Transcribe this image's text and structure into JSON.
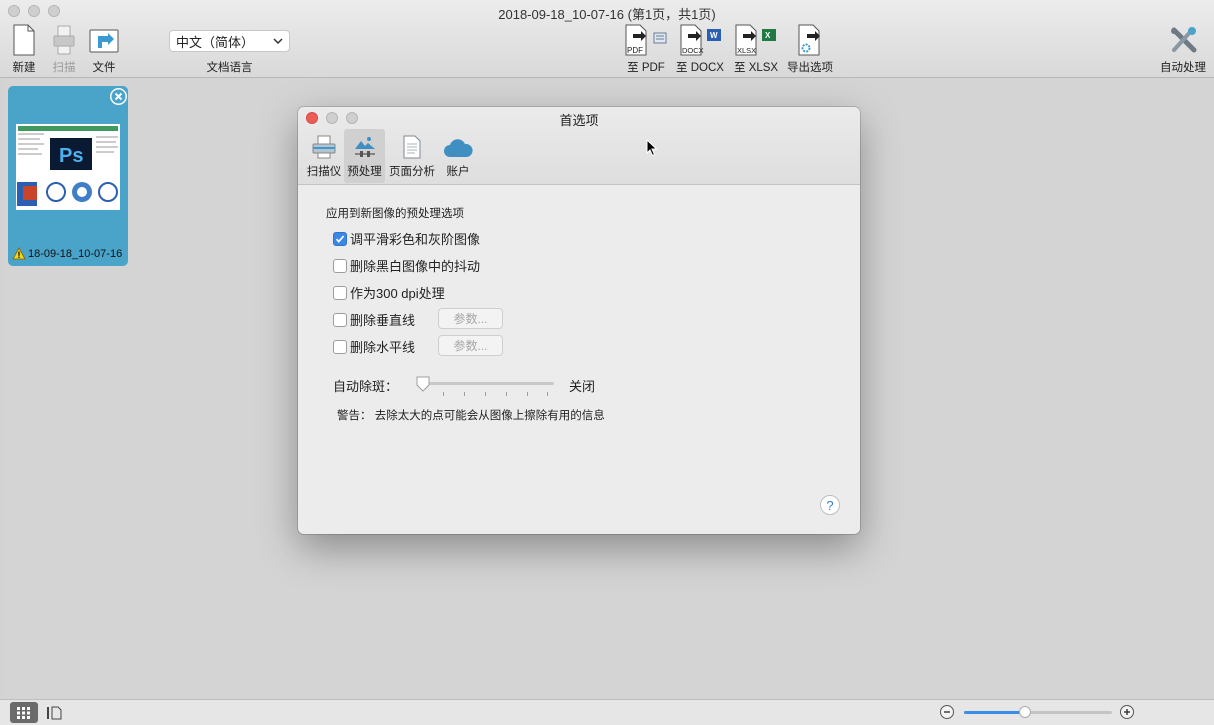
{
  "window": {
    "title": "2018-09-18_10-07-16 (第1页，共1页)"
  },
  "toolbar": {
    "new_label": "新建",
    "scan_label": "扫描",
    "file_label": "文件",
    "language_value": "中文（简体）",
    "language_label": "文档语言",
    "to_pdf_label": "至 PDF",
    "to_docx_label": "至 DOCX",
    "to_xlsx_label": "至 XLSX",
    "export_options_label": "导出选项",
    "auto_process_label": "自动处理",
    "pdf_icon_text": "PDF",
    "docx_icon_text": "DOCX",
    "xlsx_icon_text": "XLSX"
  },
  "thumbnail": {
    "name": "18-09-18_10-07-16",
    "preview_text": "Ps"
  },
  "dialog": {
    "title": "首选项",
    "tabs": [
      {
        "label": "扫描仪",
        "icon": "scanner-icon"
      },
      {
        "label": "预处理",
        "icon": "image-adjust-icon",
        "active": true
      },
      {
        "label": "页面分析",
        "icon": "page-icon"
      },
      {
        "label": "账户",
        "icon": "cloud-icon"
      }
    ],
    "section_label": "应用到新图像的预处理选项",
    "options": [
      {
        "label": "调平滑彩色和灰阶图像",
        "checked": true
      },
      {
        "label": "删除黑白图像中的抖动",
        "checked": false
      },
      {
        "label": "作为300 dpi处理",
        "checked": false
      },
      {
        "label": "删除垂直线",
        "checked": false
      },
      {
        "label": "删除水平线",
        "checked": false
      }
    ],
    "params_label": "参数...",
    "slider_label": "自动除斑：",
    "slider_value": "关闭",
    "slider_position": 0,
    "warning": "警告： 去除太大的点可能会从图像上擦除有用的信息",
    "help_label": "?"
  },
  "statusbar": {
    "zoom_level": 0.4
  },
  "colors": {
    "accent": "#3d86e6",
    "thumb_bg": "#4aa3c9",
    "close_red": "#ec5d55"
  }
}
